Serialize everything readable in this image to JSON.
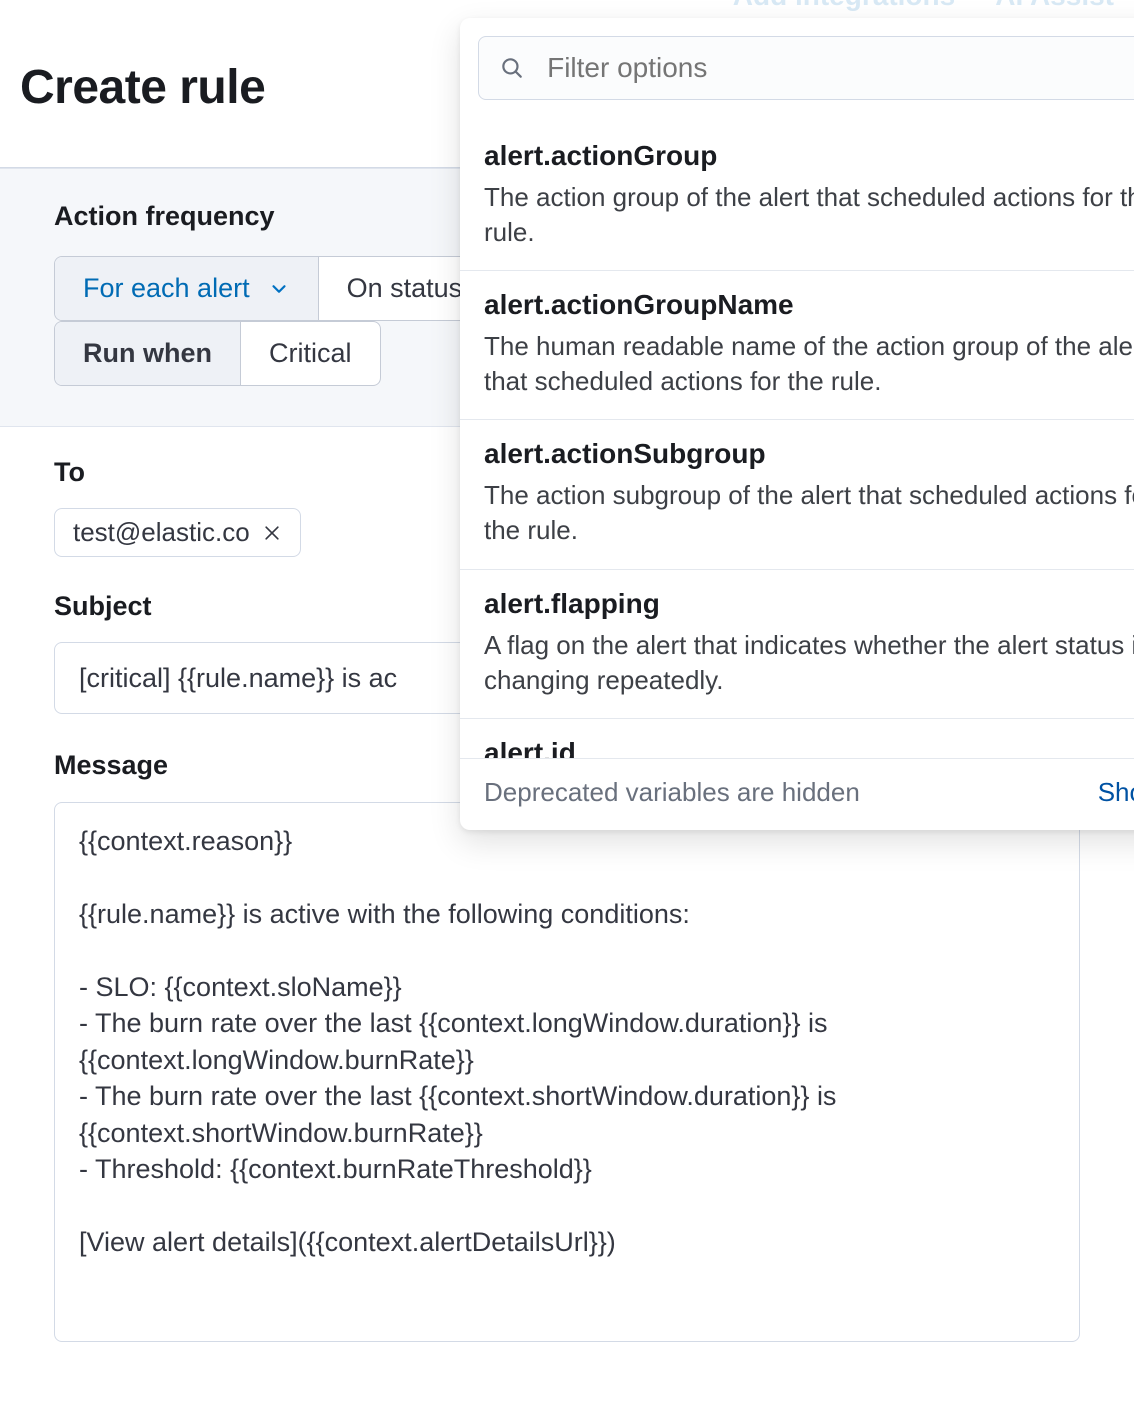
{
  "header": {
    "add_integrations": "Add integrations",
    "ai_assist": "AI Assist"
  },
  "page_title": "Create rule",
  "frequency": {
    "label": "Action frequency",
    "mode_selected": "For each alert",
    "mode_next": "On status",
    "run_when_label": "Run when",
    "run_when_value": "Critical"
  },
  "to": {
    "label": "To",
    "recipients": [
      "test@elastic.co"
    ]
  },
  "subject": {
    "label": "Subject",
    "value": "[critical] {{rule.name}} is ac"
  },
  "message": {
    "label": "Message",
    "value": "{{context.reason}}\n\n{{rule.name}} is active with the following conditions:\n\n- SLO: {{context.sloName}}\n- The burn rate over the last {{context.longWindow.duration}} is {{context.longWindow.burnRate}}\n- The burn rate over the last {{context.shortWindow.duration}} is {{context.shortWindow.burnRate}}\n- Threshold: {{context.burnRateThreshold}}\n\n[View alert details]({{context.alertDetailsUrl}})"
  },
  "popover": {
    "filter_placeholder": "Filter options",
    "options": [
      {
        "key": "alert.actionGroup",
        "desc": "The action group of the alert that scheduled actions for the rule."
      },
      {
        "key": "alert.actionGroupName",
        "desc": "The human readable name of the action group of the alert that scheduled actions for the rule."
      },
      {
        "key": "alert.actionSubgroup",
        "desc": "The action subgroup of the alert that scheduled actions for the rule."
      },
      {
        "key": "alert.flapping",
        "desc": "A flag on the alert that indicates whether the alert status is changing repeatedly."
      }
    ],
    "partial_next_key": "alert.id",
    "footer_note": "Deprecated variables are hidden",
    "show_all": "Show all"
  }
}
